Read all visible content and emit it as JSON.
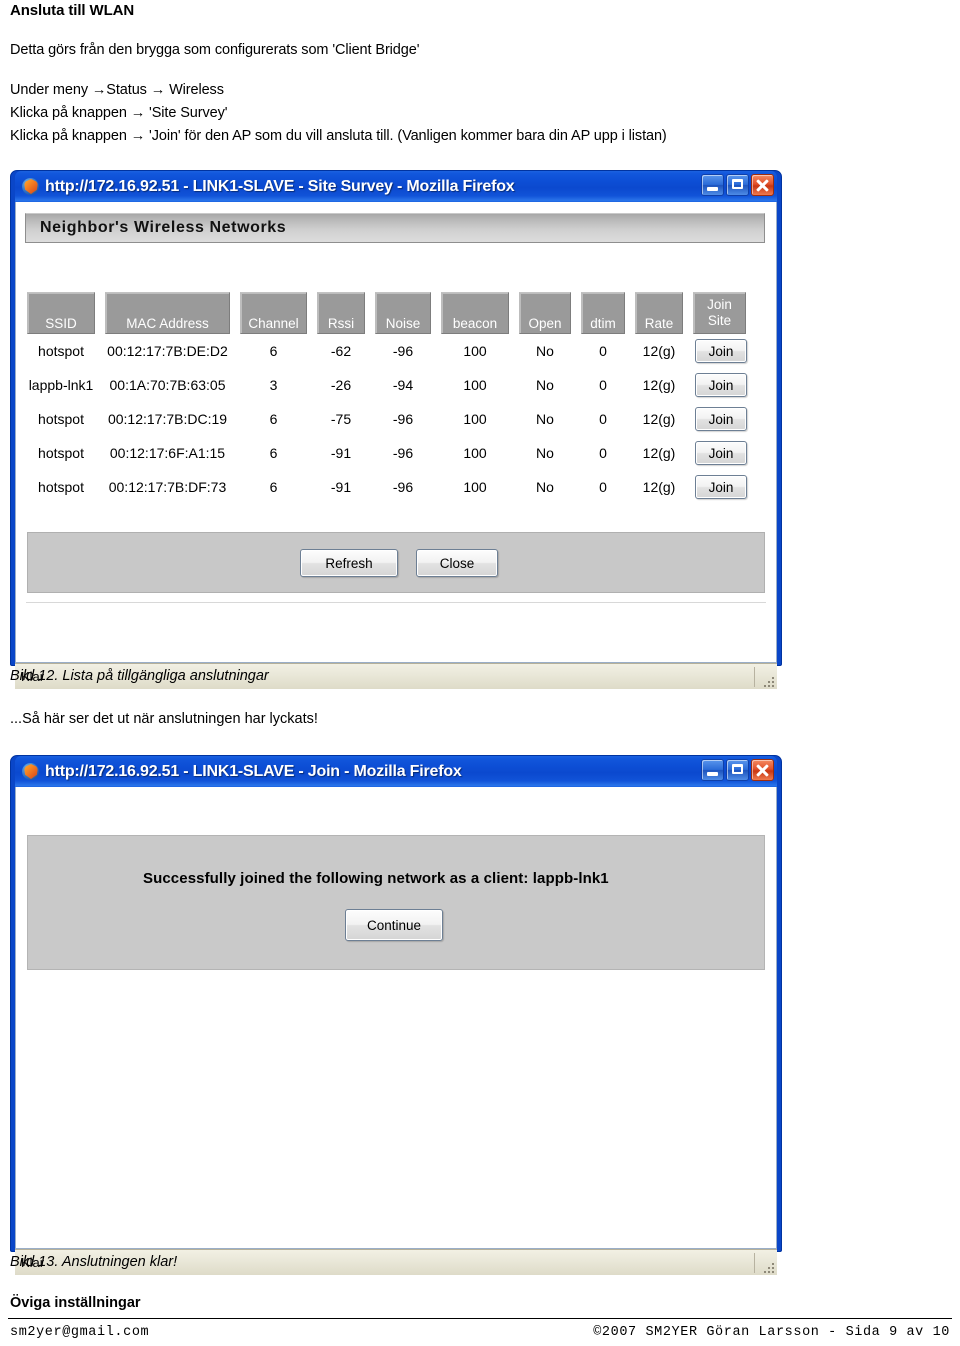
{
  "document": {
    "heading": "Ansluta till WLAN",
    "line1": "Detta görs från den brygga som configurerats som 'Client Bridge'",
    "line2": "Under meny →Status → Wireless",
    "line3": "Klicka på knappen → 'Site Survey'",
    "line4": "Klicka på knappen → 'Join' för den AP som du vill ansluta till. (Vanligen kommer bara din AP upp i listan)",
    "caption_12": "Bild 12. Lista på tillgängliga anslutningar",
    "after_caption_12": "...Så här ser det ut när anslutningen har lyckats!",
    "caption_13": "Bild 13. Anslutningen klar!",
    "section_heading": "Öviga inställningar"
  },
  "footer": {
    "email": "sm2yer@gmail.com",
    "copyright": "©2007 SM2YER Göran Larsson - Sida 9 av 10"
  },
  "window_survey": {
    "title": "http://172.16.92.51 - LINK1-SLAVE - Site Survey - Mozilla Firefox",
    "icon": "firefox-icon",
    "controls": {
      "minimize": "minimize-button",
      "maximize": "maximize-button",
      "close": "close-button"
    },
    "status": "Klar",
    "banner": "Neighbor's Wireless Networks",
    "table": {
      "headers": [
        "SSID",
        "MAC Address",
        "Channel",
        "Rssi",
        "Noise",
        "beacon",
        "Open",
        "dtim",
        "Rate",
        "Join Site"
      ],
      "join_header_line1": "Join",
      "join_header_line2": "Site",
      "rows": [
        {
          "ssid": "hotspot",
          "mac": "00:12:17:7B:DE:D2",
          "channel": "6",
          "rssi": "-62",
          "noise": "-96",
          "beacon": "100",
          "open": "No",
          "dtim": "0",
          "rate": "12(g)",
          "join": "Join"
        },
        {
          "ssid": "lappb-lnk1",
          "mac": "00:1A:70:7B:63:05",
          "channel": "3",
          "rssi": "-26",
          "noise": "-94",
          "beacon": "100",
          "open": "No",
          "dtim": "0",
          "rate": "12(g)",
          "join": "Join"
        },
        {
          "ssid": "hotspot",
          "mac": "00:12:17:7B:DC:19",
          "channel": "6",
          "rssi": "-75",
          "noise": "-96",
          "beacon": "100",
          "open": "No",
          "dtim": "0",
          "rate": "12(g)",
          "join": "Join"
        },
        {
          "ssid": "hotspot",
          "mac": "00:12:17:6F:A1:15",
          "channel": "6",
          "rssi": "-91",
          "noise": "-96",
          "beacon": "100",
          "open": "No",
          "dtim": "0",
          "rate": "12(g)",
          "join": "Join"
        },
        {
          "ssid": "hotspot",
          "mac": "00:12:17:7B:DF:73",
          "channel": "6",
          "rssi": "-91",
          "noise": "-96",
          "beacon": "100",
          "open": "No",
          "dtim": "0",
          "rate": "12(g)",
          "join": "Join"
        }
      ]
    },
    "actions": {
      "refresh": "Refresh",
      "close": "Close"
    }
  },
  "window_join": {
    "title": "http://172.16.92.51 - LINK1-SLAVE - Join - Mozilla Firefox",
    "icon": "firefox-icon",
    "controls": {
      "minimize": "minimize-button",
      "maximize": "maximize-button",
      "close": "close-button"
    },
    "status": "Klar",
    "message": "Successfully joined the following network as a client:  lappb-lnk1",
    "continue_label": "Continue"
  },
  "colors": {
    "titlebar_blue": "#0d4fd6",
    "window_border": "#0a46c8",
    "close_red": "#e2512a",
    "panel_gray": "#c9c9c9",
    "header_gray": "#9a9a9a",
    "status_bg": "#e9e7d8"
  }
}
